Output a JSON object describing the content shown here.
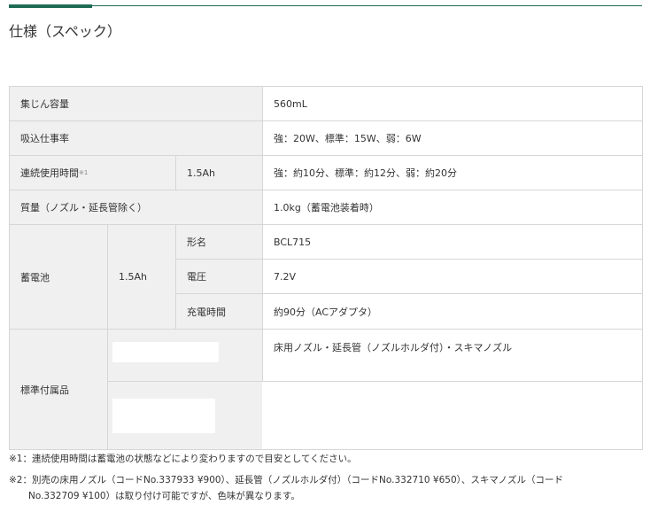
{
  "title": "仕様（スペック）",
  "rows": {
    "capacity": {
      "label": "集じん容量",
      "value": "560mL"
    },
    "power": {
      "label": "吸込仕事率",
      "value": "強：20W、標準：15W、弱：6W"
    },
    "runtime": {
      "label": "連続使用時間",
      "sup": "※1",
      "sub": "1.5Ah",
      "value": "強：約10分、標準：約12分、弱：約20分"
    },
    "weight": {
      "label": "質量（ノズル・延長管除く）",
      "value": "1.0kg（蓄電池装着時）"
    },
    "battery": {
      "label": "蓄電池",
      "sub": "1.5Ah",
      "items": [
        {
          "label": "形名",
          "value": "BCL715"
        },
        {
          "label": "電圧",
          "value": "7.2V"
        },
        {
          "label": "充電時間",
          "value": "約90分（ACアダプタ）"
        }
      ]
    },
    "accessories": {
      "label": "標準付属品",
      "value": "床用ノズル・延長管（ノズルホルダ付）・スキマノズル"
    }
  },
  "notes": [
    "※1：連続使用時間は蓄電池の状態などにより変わりますので目安としてください。",
    "※2：別売の床用ノズル（コードNo.337933 ¥900）、延長管（ノズルホルダ付）（コードNo.332710 ¥650）、スキマノズル（コード",
    "No.332709 ¥100）は取り付け可能ですが、色味が異なります。"
  ]
}
